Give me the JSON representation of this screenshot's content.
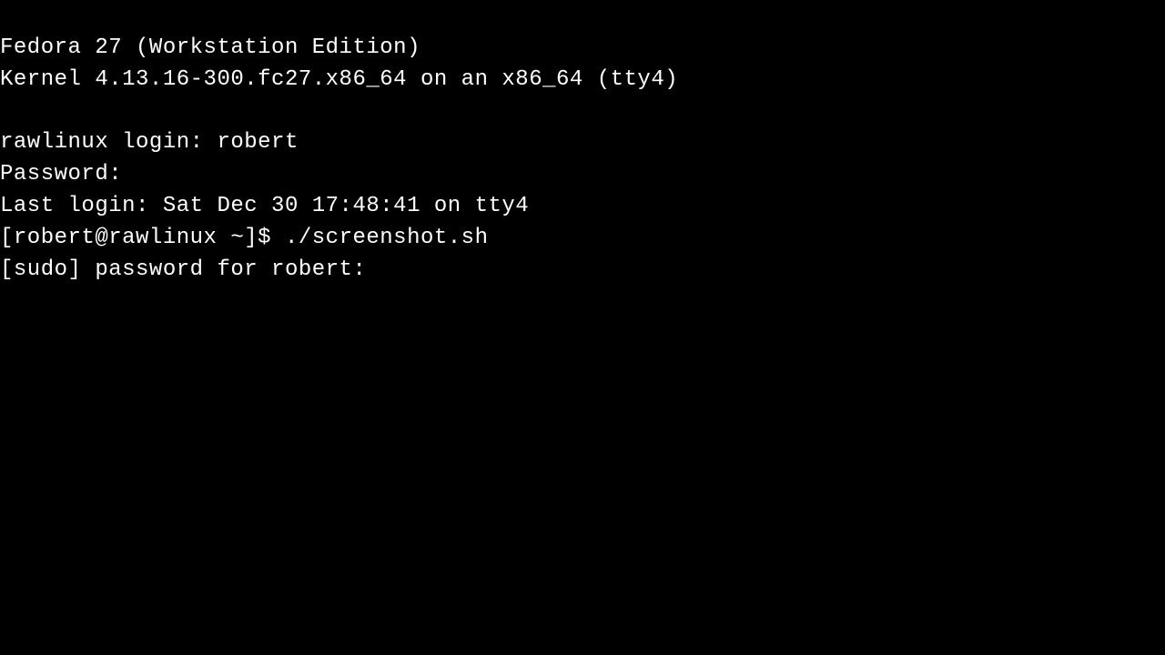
{
  "tty": {
    "issue_line1": "Fedora 27 (Workstation Edition)",
    "issue_line2": "Kernel 4.13.16-300.fc27.x86_64 on an x86_64 (tty4)",
    "login_prompt": "rawlinux login: ",
    "login_user": "robert",
    "password_prompt": "Password:",
    "last_login": "Last login: Sat Dec 30 17:48:41 on tty4",
    "shell_prompt": "[robert@rawlinux ~]$ ",
    "shell_command": "./screenshot.sh",
    "sudo_prompt": "[sudo] password for robert: "
  }
}
